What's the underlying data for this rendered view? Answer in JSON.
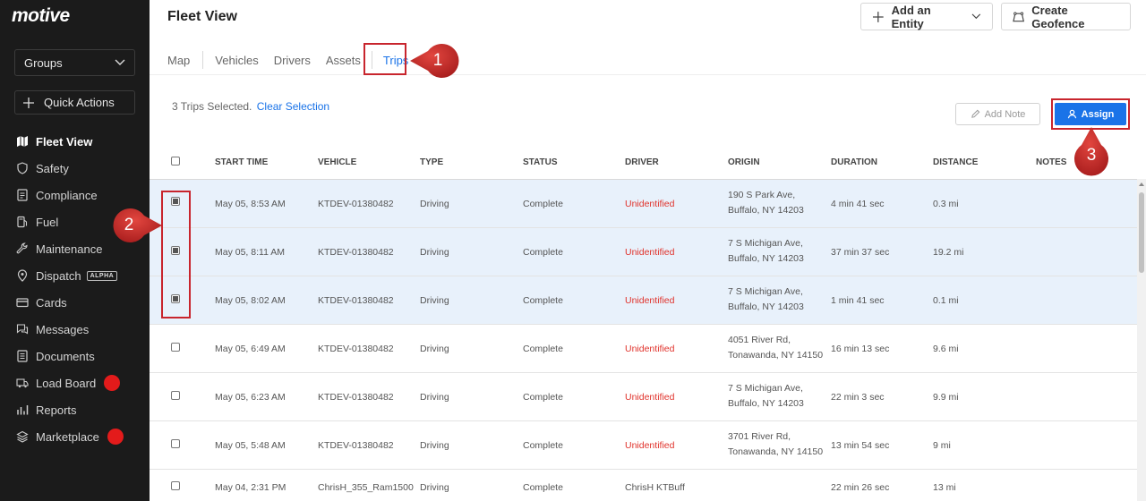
{
  "brand": {
    "logo_text": "motive"
  },
  "sidebar": {
    "groups_label": "Groups",
    "quick_actions_label": "Quick Actions",
    "items": [
      {
        "label": "Fleet View",
        "icon": "map-icon",
        "active": true
      },
      {
        "label": "Safety",
        "icon": "shield-icon"
      },
      {
        "label": "Compliance",
        "icon": "document-icon"
      },
      {
        "label": "Fuel",
        "icon": "fuel-icon"
      },
      {
        "label": "Maintenance",
        "icon": "wrench-icon"
      },
      {
        "label": "Dispatch",
        "icon": "location-pin-icon",
        "badge": "ALPHA"
      },
      {
        "label": "Cards",
        "icon": "card-icon"
      },
      {
        "label": "Messages",
        "icon": "messages-icon"
      },
      {
        "label": "Documents",
        "icon": "documents-icon"
      },
      {
        "label": "Load Board",
        "icon": "truck-icon",
        "dot": true
      },
      {
        "label": "Reports",
        "icon": "chart-icon"
      },
      {
        "label": "Marketplace",
        "icon": "layers-icon",
        "dot": true
      }
    ]
  },
  "header": {
    "title": "Fleet View",
    "add_entity_label": "Add an Entity",
    "create_geofence_label": "Create Geofence"
  },
  "tabs": [
    "Map",
    "Vehicles",
    "Drivers",
    "Assets",
    "Trips"
  ],
  "active_tab": "Trips",
  "selection": {
    "text": "3 Trips Selected.",
    "clear_label": "Clear Selection",
    "add_note_label": "Add Note",
    "assign_label": "Assign"
  },
  "table": {
    "columns": [
      "START TIME",
      "VEHICLE",
      "TYPE",
      "STATUS",
      "DRIVER",
      "ORIGIN",
      "DURATION",
      "DISTANCE",
      "NOTES"
    ],
    "rows": [
      {
        "checked": true,
        "start_time": "May 05, 8:53 AM",
        "vehicle": "KTDEV-01380482",
        "type": "Driving",
        "status": "Complete",
        "driver": "Unidentified",
        "origin_line1": "190 S Park Ave,",
        "origin_line2": "Buffalo, NY 14203",
        "duration": "4 min 41 sec",
        "distance": "0.3 mi",
        "notes": ""
      },
      {
        "checked": true,
        "start_time": "May 05, 8:11 AM",
        "vehicle": "KTDEV-01380482",
        "type": "Driving",
        "status": "Complete",
        "driver": "Unidentified",
        "origin_line1": "7 S Michigan Ave,",
        "origin_line2": "Buffalo, NY 14203",
        "duration": "37 min 37 sec",
        "distance": "19.2 mi",
        "notes": ""
      },
      {
        "checked": true,
        "start_time": "May 05, 8:02 AM",
        "vehicle": "KTDEV-01380482",
        "type": "Driving",
        "status": "Complete",
        "driver": "Unidentified",
        "origin_line1": "7 S Michigan Ave,",
        "origin_line2": "Buffalo, NY 14203",
        "duration": "1 min 41 sec",
        "distance": "0.1 mi",
        "notes": ""
      },
      {
        "checked": false,
        "start_time": "May 05, 6:49 AM",
        "vehicle": "KTDEV-01380482",
        "type": "Driving",
        "status": "Complete",
        "driver": "Unidentified",
        "origin_line1": "4051 River Rd,",
        "origin_line2": "Tonawanda, NY 14150",
        "duration": "16 min 13 sec",
        "distance": "9.6 mi",
        "notes": ""
      },
      {
        "checked": false,
        "start_time": "May 05, 6:23 AM",
        "vehicle": "KTDEV-01380482",
        "type": "Driving",
        "status": "Complete",
        "driver": "Unidentified",
        "origin_line1": "7 S Michigan Ave,",
        "origin_line2": "Buffalo, NY 14203",
        "duration": "22 min 3 sec",
        "distance": "9.9 mi",
        "notes": ""
      },
      {
        "checked": false,
        "start_time": "May 05, 5:48 AM",
        "vehicle": "KTDEV-01380482",
        "type": "Driving",
        "status": "Complete",
        "driver": "Unidentified",
        "origin_line1": "3701 River Rd,",
        "origin_line2": "Tonawanda, NY 14150",
        "duration": "13 min 54 sec",
        "distance": "9 mi",
        "notes": ""
      },
      {
        "checked": false,
        "start_time": "May 04, 2:31 PM",
        "vehicle": "ChrisH_355_Ram1500",
        "type": "Driving",
        "status": "Complete",
        "driver": "ChrisH KTBuff",
        "origin_line1": "",
        "origin_line2": "",
        "duration": "22 min 26 sec",
        "distance": "13 mi",
        "notes": ""
      }
    ]
  },
  "annotations": {
    "callouts": [
      "1",
      "2",
      "3"
    ],
    "color": "#c8252d"
  },
  "colors": {
    "accent": "#1a73e8",
    "sidebar_bg": "#1b1b1b",
    "unidentified": "#e0322b",
    "selected_row": "#e8f1fb"
  }
}
